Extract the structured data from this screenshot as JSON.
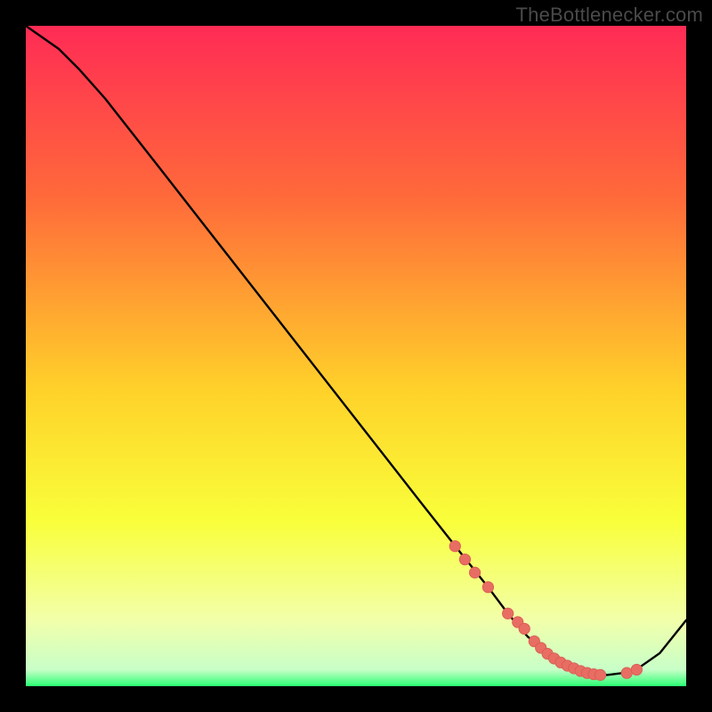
{
  "watermark": "TheBottlenecker.com",
  "colors": {
    "gradient_top": "#ff2b55",
    "gradient_mid_upper": "#ff6a3a",
    "gradient_mid": "#ffd12a",
    "gradient_mid_lower": "#f9ff3a",
    "gradient_pale": "#f2ffaa",
    "gradient_green": "#2aff73",
    "line": "#000000",
    "marker_fill": "#e86d63",
    "marker_stroke": "#d85a52",
    "frame_bg": "#000000"
  },
  "chart_data": {
    "type": "line",
    "title": "",
    "xlabel": "",
    "ylabel": "",
    "xlim": [
      0,
      100
    ],
    "ylim": [
      0,
      100
    ],
    "series": [
      {
        "name": "bottleneck-curve",
        "x": [
          0,
          5,
          8,
          12,
          20,
          30,
          40,
          50,
          60,
          66,
          70,
          73,
          76,
          80,
          84,
          88,
          92,
          96,
          100
        ],
        "y": [
          100,
          96.5,
          93.5,
          89,
          78.8,
          66,
          53.2,
          40.4,
          27.6,
          20,
          15,
          11,
          7.5,
          4.2,
          2.3,
          1.7,
          2.2,
          5,
          10
        ]
      }
    ],
    "markers": {
      "name": "highlight-points",
      "x": [
        65,
        66.5,
        68,
        70,
        73,
        74.5,
        75.5,
        77,
        78,
        79,
        80,
        81,
        82,
        83,
        84,
        85,
        86,
        87,
        91,
        92.5
      ],
      "y": [
        21.2,
        19.2,
        17.2,
        15,
        11,
        9.7,
        8.7,
        6.8,
        5.8,
        4.9,
        4.2,
        3.6,
        3.1,
        2.7,
        2.3,
        2.0,
        1.8,
        1.7,
        2.0,
        2.5
      ]
    }
  }
}
